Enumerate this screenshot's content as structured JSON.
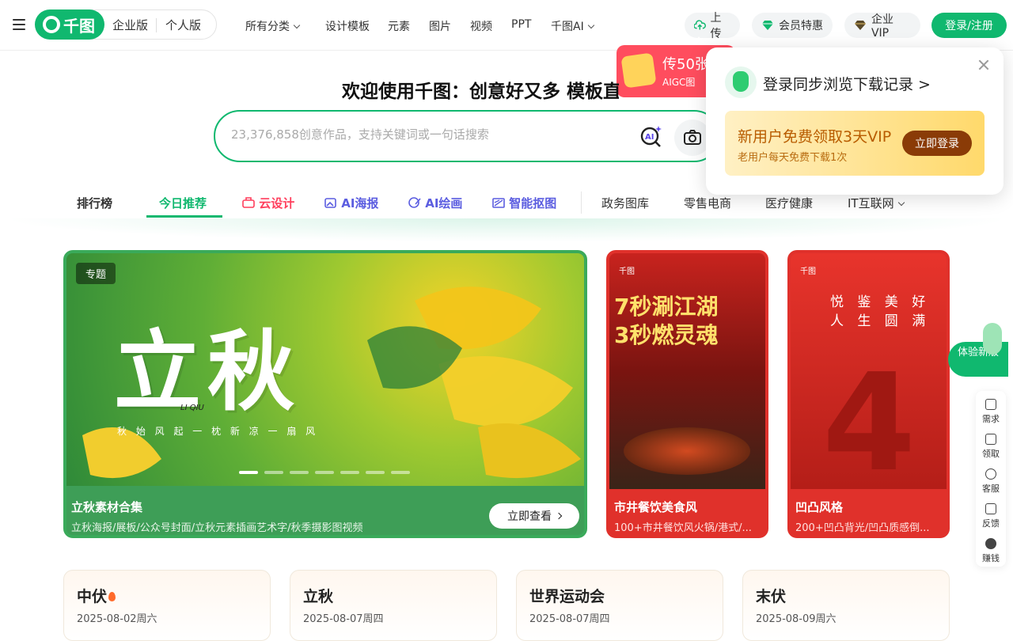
{
  "header": {
    "logo_text": "千图",
    "versions": [
      "企业版",
      "个人版"
    ],
    "nav": [
      "所有分类",
      "设计模板",
      "元素",
      "图片",
      "视频",
      "PPT",
      "千图AI"
    ],
    "upload": "上传",
    "member": "会员特惠",
    "enterprise_vip": "企业VIP",
    "login": "登录/注册"
  },
  "promo": {
    "title": "传50张",
    "subtitle": "AIGC图",
    "bg": "#ff4d5e"
  },
  "popup": {
    "title": "登录同步浏览下载记录 >",
    "vip_title": "新用户免费领取3天VIP",
    "vip_sub": "老用户每天免费下载1次",
    "vip_btn": "立即登录"
  },
  "hero": {
    "title": "欢迎使用千图：创意好又多 模板直",
    "search_placeholder": "23,376,858创意作品，支持关键词或一句话搜索"
  },
  "tabs": [
    "排行榜",
    "今日推荐",
    "云设计",
    "AI海报",
    "AI绘画",
    "智能抠图",
    "政务图库",
    "零售电商",
    "医疗健康",
    "IT互联网"
  ],
  "banner": {
    "tag": "专题",
    "big": "立秋",
    "pinyin": "LI QIU",
    "sub": "秋 始 风 起   一 枕 新 凉   一 扇 风",
    "caption": "立秋素材合集",
    "desc": "立秋海报/展板/公众号封面/立秋元素插画艺术字/秋季摄影图视频",
    "view_btn": "立即查看",
    "dots": 7
  },
  "cards": [
    {
      "logo": "千图",
      "art": "7秒涮江湖\n3秒燃灵魂",
      "caption": "市井餐饮美食风",
      "desc": "100+市井餐饮风火锅/港式/..."
    },
    {
      "logo": "千图",
      "art": "悦 鉴 美 好\n人 生 圆 满",
      "caption": "凹凸风格",
      "desc": "200+凹凸背光/凹凸质感倒..."
    }
  ],
  "festivals": [
    {
      "name": "中伏",
      "date": "2025-08-02周六",
      "hot": true
    },
    {
      "name": "立秋",
      "date": "2025-08-07周四",
      "hot": false
    },
    {
      "name": "世界运动会",
      "date": "2025-08-07周四",
      "hot": false
    },
    {
      "name": "末伏",
      "date": "2025-08-09周六",
      "hot": false
    }
  ],
  "side": {
    "try": "体验新版",
    "tools": [
      "需求",
      "领取",
      "客服",
      "反馈",
      "赚钱"
    ]
  },
  "colors": {
    "brand": "#10b86f",
    "red": "#e0312b"
  }
}
